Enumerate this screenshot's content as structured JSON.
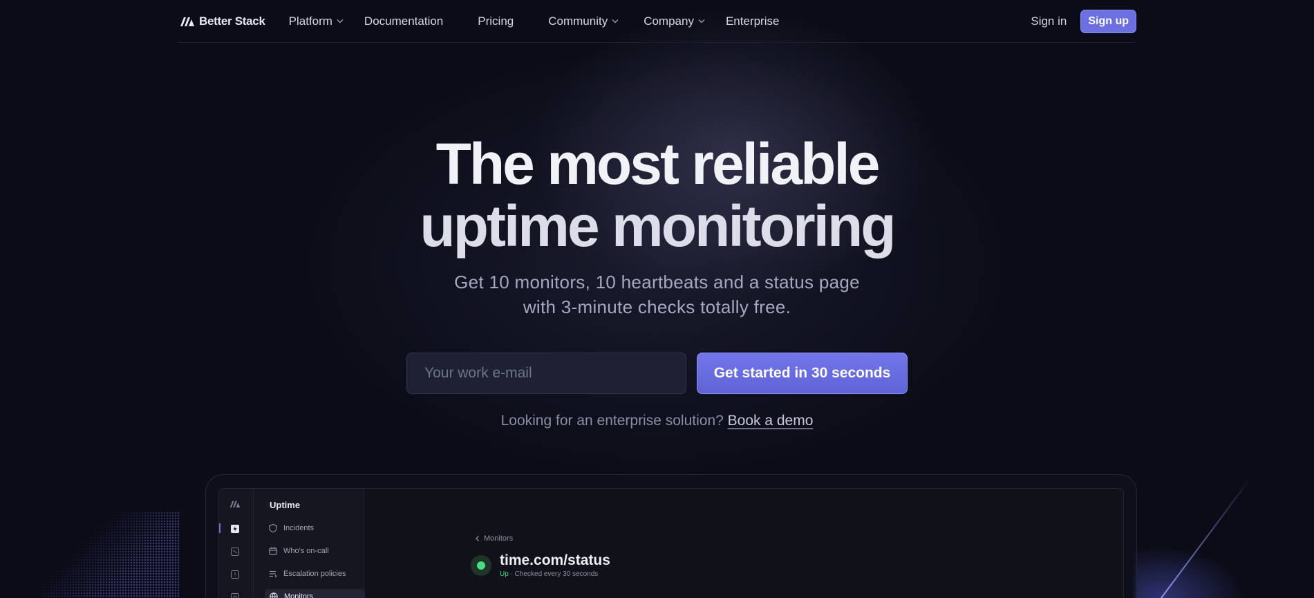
{
  "nav": {
    "logo_text": "Better Stack",
    "items": [
      {
        "label": "Platform",
        "has_dropdown": true
      },
      {
        "label": "Documentation",
        "has_dropdown": false
      },
      {
        "label": "Pricing",
        "has_dropdown": false
      },
      {
        "label": "Community",
        "has_dropdown": true
      },
      {
        "label": "Company",
        "has_dropdown": true
      },
      {
        "label": "Enterprise",
        "has_dropdown": false
      }
    ],
    "sign_in": "Sign in",
    "sign_up": "Sign up"
  },
  "hero": {
    "title_line1": "The most reliable",
    "title_line2": "uptime monitoring",
    "subtitle_line1": "Get 10 monitors, 10 heartbeats and a status page",
    "subtitle_line2": "with 3-minute checks totally free.",
    "email_placeholder": "Your work e-mail",
    "cta_label": "Get started in 30 seconds",
    "enterprise_text": "Looking for an enterprise solution?",
    "demo_link": "Book a demo"
  },
  "preview": {
    "sidebar_title": "Uptime",
    "sidebar_items": [
      {
        "label": "Incidents",
        "icon": "shield-icon"
      },
      {
        "label": "Who's on-call",
        "icon": "calendar-icon"
      },
      {
        "label": "Escalation policies",
        "icon": "list-icon"
      },
      {
        "label": "Monitors",
        "icon": "globe-icon",
        "active": true
      }
    ],
    "breadcrumb": "Monitors",
    "monitor_name": "time.com/status",
    "monitor_status": "Up",
    "monitor_detail": "· Checked every 30 seconds"
  },
  "colors": {
    "background": "#0b0c17",
    "accent": "#6b6fe0",
    "status_up": "#4ade80"
  }
}
